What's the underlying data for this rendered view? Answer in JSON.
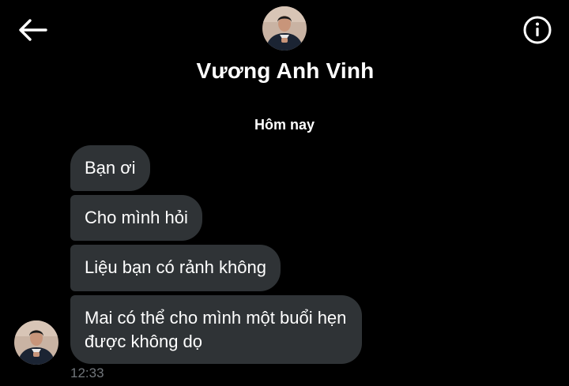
{
  "header": {
    "contact_name": "Vương Anh Vinh",
    "back_icon": "arrow-left-icon",
    "info_icon": "info-circle-icon"
  },
  "conversation": {
    "date_divider": "Hôm nay",
    "messages": [
      {
        "text": "Bạn ơi"
      },
      {
        "text": "Cho mình hỏi"
      },
      {
        "text": "Liệu bạn có rảnh không"
      },
      {
        "text": "Mai có thể cho mình một buổi hẹn được không dọ"
      }
    ],
    "timestamp": "12:33"
  },
  "colors": {
    "background": "#000000",
    "bubble": "#2f3336",
    "text": "#ffffff",
    "muted": "#71767b"
  }
}
